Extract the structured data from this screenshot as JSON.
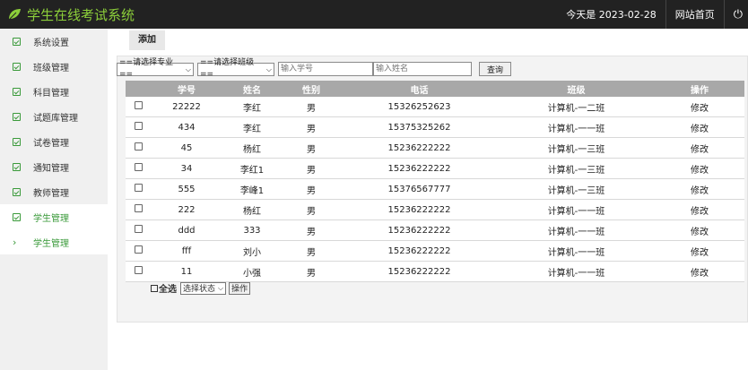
{
  "header": {
    "title": "学生在线考试系统",
    "date_text": "今天是 2023-02-28",
    "home_link": "网站首页",
    "power_icon": "power-icon"
  },
  "sidebar": {
    "items": [
      {
        "label": "系统设置"
      },
      {
        "label": "班级管理"
      },
      {
        "label": "科目管理"
      },
      {
        "label": "试题库管理"
      },
      {
        "label": "试卷管理"
      },
      {
        "label": "通知管理"
      },
      {
        "label": "教师管理"
      },
      {
        "label": "学生管理"
      }
    ],
    "sub_item": {
      "arrow": "›",
      "label": "学生管理"
    }
  },
  "tabs": {
    "add_label": "添加"
  },
  "filters": {
    "major_select": "==请选择专业==",
    "class_select": "==请选择班级==",
    "student_id_placeholder": "输入学号",
    "name_placeholder": "输入姓名",
    "query_button": "查询"
  },
  "table": {
    "headers": [
      "学号",
      "姓名",
      "性别",
      "电话",
      "班级",
      "操作"
    ],
    "rows": [
      {
        "id": "22222",
        "name": "李红",
        "gender": "男",
        "phone": "15326252623",
        "class": "计算机-一二班",
        "action": "修改"
      },
      {
        "id": "434",
        "name": "李红",
        "gender": "男",
        "phone": "15375325262",
        "class": "计算机-一一班",
        "action": "修改"
      },
      {
        "id": "45",
        "name": "杨红",
        "gender": "男",
        "phone": "15236222222",
        "class": "计算机-一三班",
        "action": "修改"
      },
      {
        "id": "34",
        "name": "李红1",
        "gender": "男",
        "phone": "15236222222",
        "class": "计算机-一三班",
        "action": "修改"
      },
      {
        "id": "555",
        "name": "李峰1",
        "gender": "男",
        "phone": "15376567777",
        "class": "计算机-一三班",
        "action": "修改"
      },
      {
        "id": "222",
        "name": "杨红",
        "gender": "男",
        "phone": "15236222222",
        "class": "计算机-一一班",
        "action": "修改"
      },
      {
        "id": "ddd",
        "name": "333",
        "gender": "男",
        "phone": "15236222222",
        "class": "计算机-一一班",
        "action": "修改"
      },
      {
        "id": "fff",
        "name": "刘小",
        "gender": "男",
        "phone": "15236222222",
        "class": "计算机-一一班",
        "action": "修改"
      },
      {
        "id": "11",
        "name": "小强",
        "gender": "男",
        "phone": "15236222222",
        "class": "计算机-一一班",
        "action": "修改"
      }
    ]
  },
  "footer": {
    "select_all": "全选",
    "status_select": "选择状态",
    "action_button": "操作"
  },
  "colors": {
    "brand": "#8ccf3a",
    "accent": "#3a9a3a",
    "header_bg": "#222222",
    "table_header": "#a8a8a8"
  }
}
